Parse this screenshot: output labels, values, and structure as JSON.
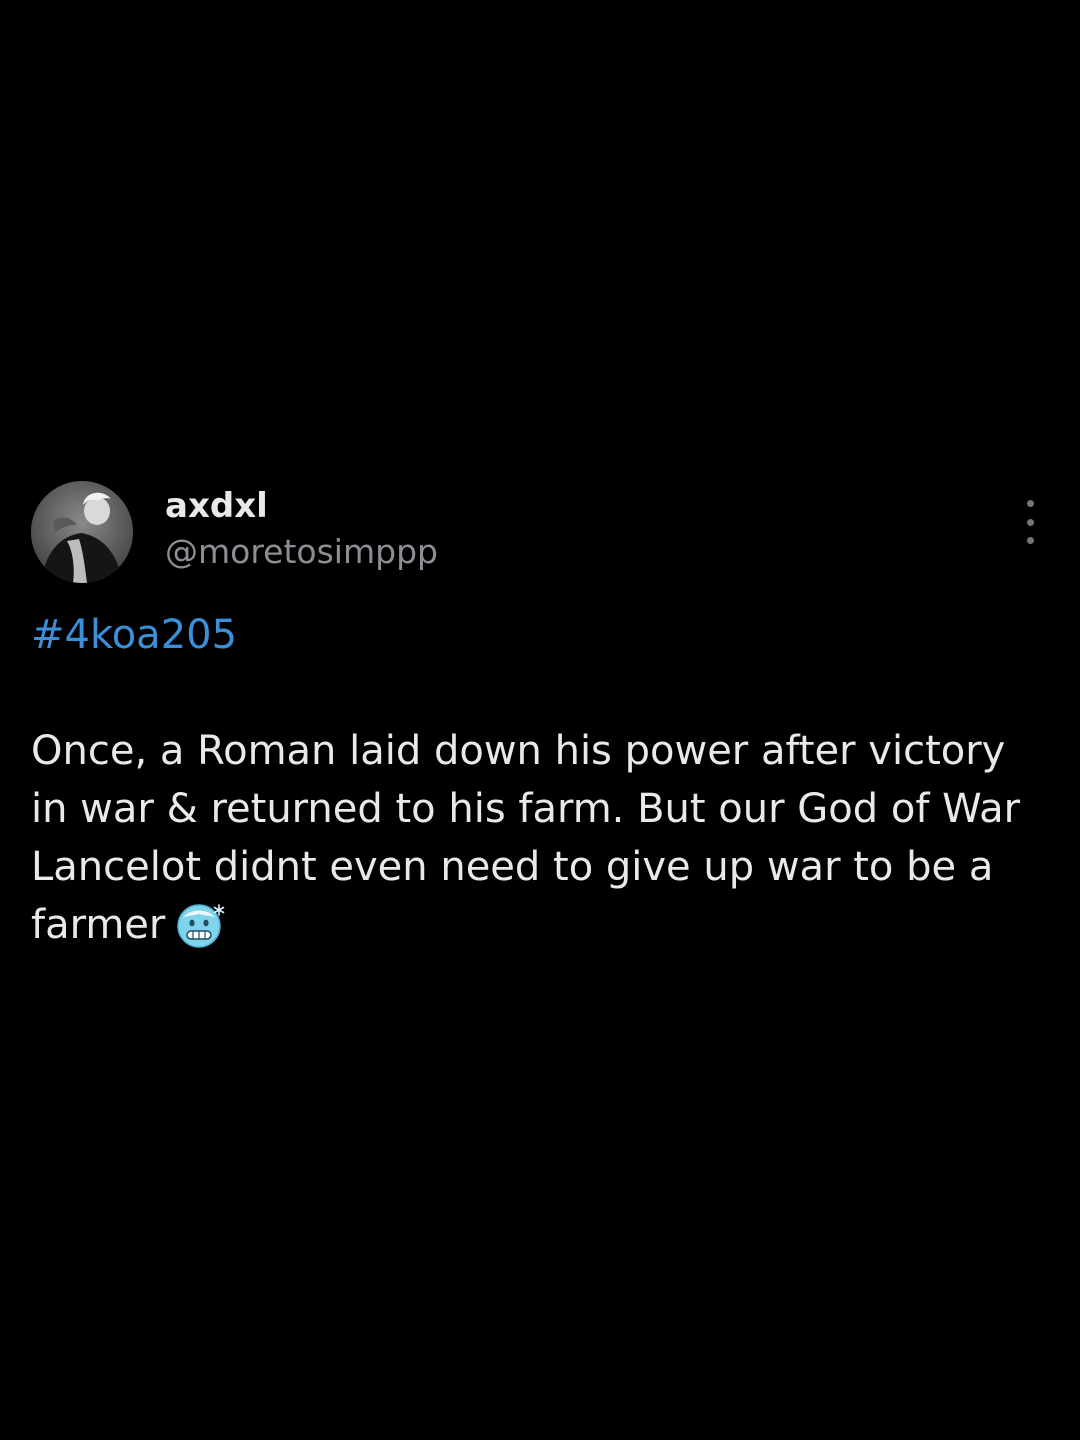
{
  "post": {
    "author": {
      "display_name": "axdxl",
      "handle": "@moretosimppp",
      "avatar_icon": "profile-avatar"
    },
    "menu_icon": "more-vertical-icon",
    "hashtag": "#4koa205",
    "body_lines": [
      "Once, a Roman laid down his power after victory",
      "in war & returned to his farm. But our God of War",
      "Lancelot didnt even need to give up war to be a",
      "farmer"
    ],
    "emoji": "cold-face-emoji",
    "colors": {
      "background": "#000000",
      "text": "#e7e9ea",
      "secondary_text": "#8b8f94",
      "link": "#3b8fd9"
    }
  }
}
